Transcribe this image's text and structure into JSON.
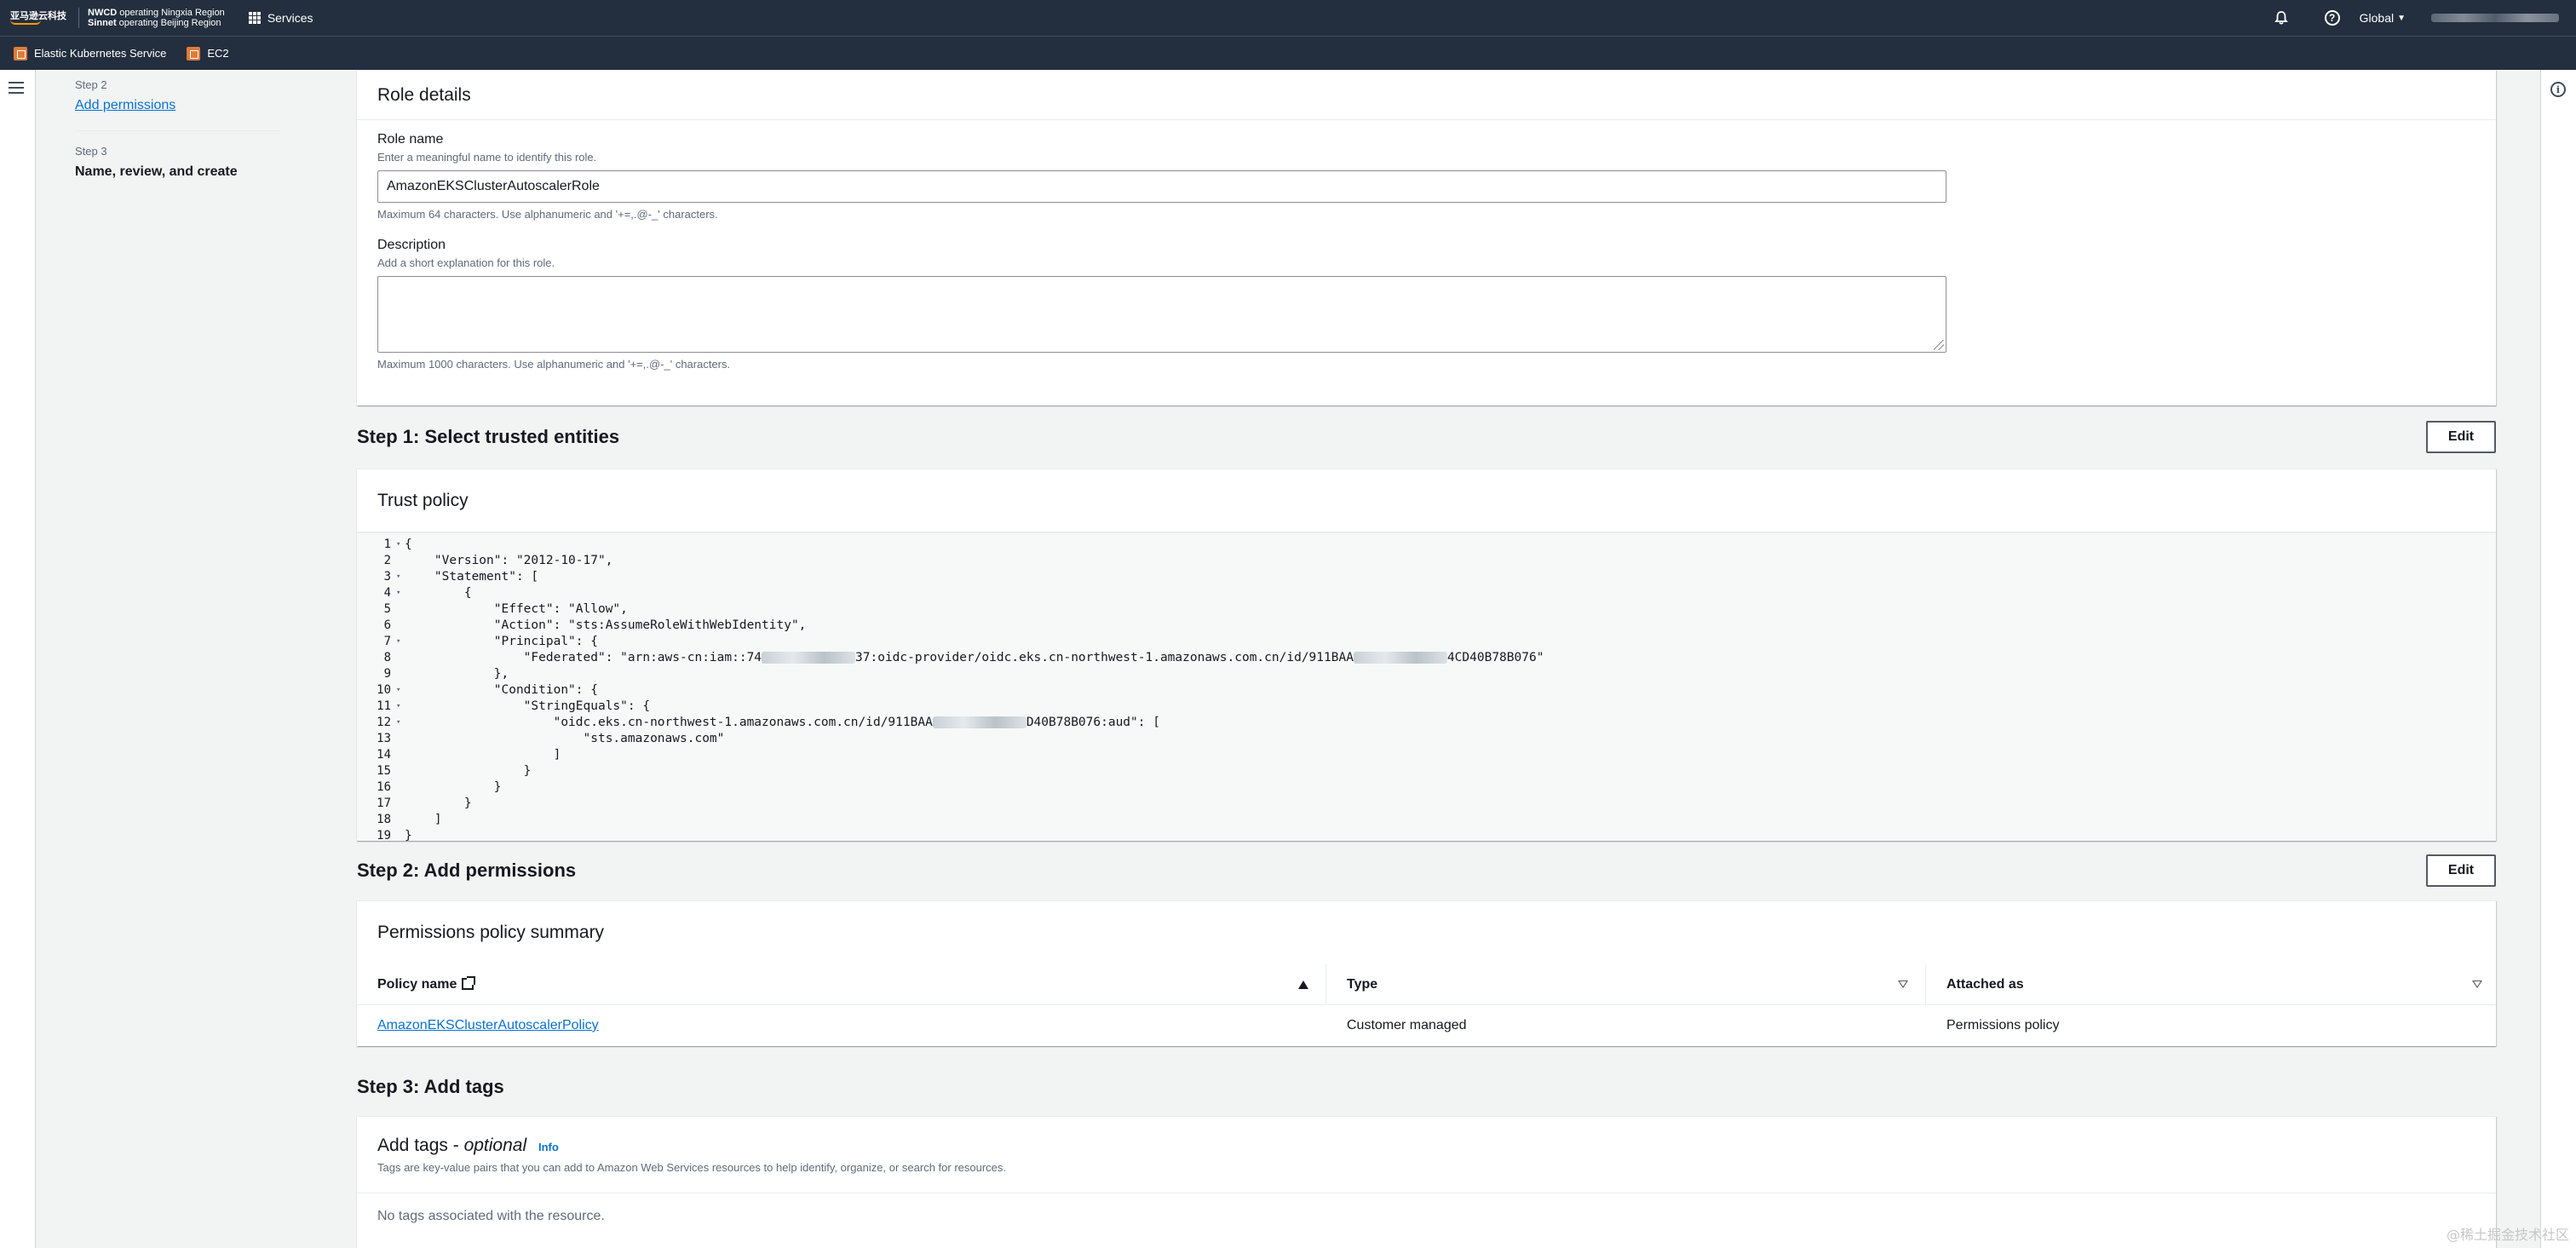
{
  "topnav": {
    "logo_text": "亚马逊云科技",
    "region_line1_bold": "NWCD",
    "region_line1_rest": " operating Ningxia Region",
    "region_line2_bold": "Sinnet",
    "region_line2_rest": " operating Beijing Region",
    "services_label": "Services",
    "region_selector": "Global",
    "icons": [
      "bell-icon",
      "help-icon",
      "chevron-down-icon"
    ]
  },
  "favorites": [
    {
      "label": "Elastic Kubernetes Service"
    },
    {
      "label": "EC2"
    }
  ],
  "steps": {
    "step2_label": "Step 2",
    "step2_link": "Add permissions",
    "step3_label": "Step 3",
    "step3_title": "Name, review, and create"
  },
  "role_details": {
    "header": "Role details",
    "name_label": "Role name",
    "name_desc": "Enter a meaningful name to identify this role.",
    "name_value": "AmazonEKSClusterAutoscalerRole",
    "name_constraint": "Maximum 64 characters. Use alphanumeric and '+=,.@-_' characters.",
    "desc_label": "Description",
    "desc_desc": "Add a short explanation for this role.",
    "desc_value": "",
    "desc_constraint": "Maximum 1000 characters. Use alphanumeric and '+=,.@-_' characters."
  },
  "step1": {
    "title": "Step 1: Select trusted entities",
    "edit": "Edit",
    "card_header": "Trust policy",
    "code_lines": [
      {
        "n": "1",
        "fold": true,
        "text": "{"
      },
      {
        "n": "2",
        "fold": false,
        "text": "    \"Version\": \"2012-10-17\","
      },
      {
        "n": "3",
        "fold": true,
        "text": "    \"Statement\": ["
      },
      {
        "n": "4",
        "fold": true,
        "text": "        {"
      },
      {
        "n": "5",
        "fold": false,
        "text": "            \"Effect\": \"Allow\","
      },
      {
        "n": "6",
        "fold": false,
        "text": "            \"Action\": \"sts:AssumeRoleWithWebIdentity\","
      },
      {
        "n": "7",
        "fold": true,
        "text": "            \"Principal\": {"
      },
      {
        "n": "8",
        "fold": false,
        "text": "                \"Federated\": \"arn:aws-cn:iam::74",
        "blur": true,
        "after": "37:oidc-provider/oidc.eks.cn-northwest-1.amazonaws.com.cn/id/911BAA",
        "blur2": true,
        "after2": "4CD40B78B076\""
      },
      {
        "n": "9",
        "fold": false,
        "text": "            },"
      },
      {
        "n": "10",
        "fold": true,
        "text": "            \"Condition\": {"
      },
      {
        "n": "11",
        "fold": true,
        "text": "                \"StringEquals\": {"
      },
      {
        "n": "12",
        "fold": true,
        "text": "                    \"oidc.eks.cn-northwest-1.amazonaws.com.cn/id/911BAA",
        "blur": true,
        "after": "D40B78B076:aud\": ["
      },
      {
        "n": "13",
        "fold": false,
        "text": "                        \"sts.amazonaws.com\""
      },
      {
        "n": "14",
        "fold": false,
        "text": "                    ]"
      },
      {
        "n": "15",
        "fold": false,
        "text": "                }"
      },
      {
        "n": "16",
        "fold": false,
        "text": "            }"
      },
      {
        "n": "17",
        "fold": false,
        "text": "        }"
      },
      {
        "n": "18",
        "fold": false,
        "text": "    ]"
      },
      {
        "n": "19",
        "fold": false,
        "text": "}"
      }
    ]
  },
  "step2": {
    "title": "Step 2: Add permissions",
    "edit": "Edit",
    "card_header": "Permissions policy summary",
    "columns": [
      "Policy name",
      "Type",
      "Attached as"
    ],
    "rows": [
      {
        "name": "AmazonEKSClusterAutoscalerPolicy",
        "type": "Customer managed",
        "attached": "Permissions policy"
      }
    ]
  },
  "step3": {
    "title": "Step 3: Add tags",
    "card_title": "Add tags - ",
    "card_title_italic": "optional",
    "info": "Info",
    "desc": "Tags are key-value pairs that you can add to Amazon Web Services resources to help identify, organize, or search for resources.",
    "empty": "No tags associated with the resource."
  },
  "watermark": "@稀土掘金技术社区"
}
